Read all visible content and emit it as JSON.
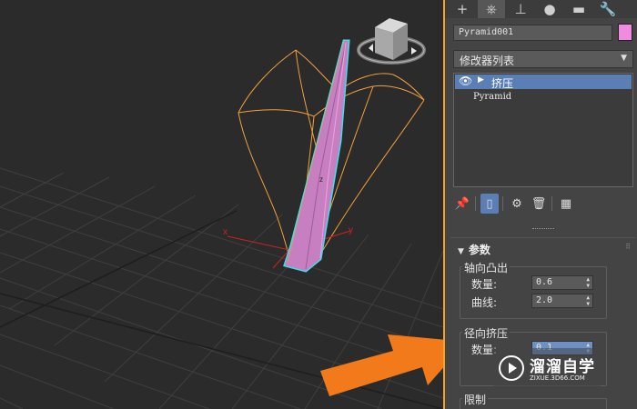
{
  "viewport": {
    "axis_labels": {
      "x": "x",
      "y": "y",
      "z": "z"
    },
    "colors": {
      "grid": "#3d3d3d",
      "cage": "#f3a03a",
      "object": "#e58ee0",
      "selection": "#3ce0e8"
    }
  },
  "panel": {
    "tabs": [
      {
        "icon": "plus-icon",
        "glyph": "+"
      },
      {
        "icon": "modify-icon",
        "glyph": "⎈"
      },
      {
        "icon": "hierarchy-icon",
        "glyph": "⊥"
      },
      {
        "icon": "motion-icon",
        "glyph": "●"
      },
      {
        "icon": "display-icon",
        "glyph": "▬"
      },
      {
        "icon": "utilities-icon",
        "glyph": "🔧"
      }
    ],
    "object_name": "Pyramid001",
    "object_color": "#f08ce0",
    "modifier_list": "修改器列表",
    "stack": [
      {
        "label": "挤压",
        "selected": true
      },
      {
        "label": "Pyramid",
        "selected": false
      }
    ],
    "params": {
      "title": "参数",
      "axial_bulge": {
        "title": "轴向凸出",
        "amount_label": "数量:",
        "amount_value": "0.6",
        "curve_label": "曲线:",
        "curve_value": "2.0"
      },
      "radial_squeeze": {
        "title": "径向挤压",
        "amount_label": "数量:",
        "amount_value": "0.1"
      },
      "limits_title": "限制"
    }
  },
  "watermark": {
    "title": "溜溜自学",
    "url": "ZIXUE.3D66.COM"
  }
}
